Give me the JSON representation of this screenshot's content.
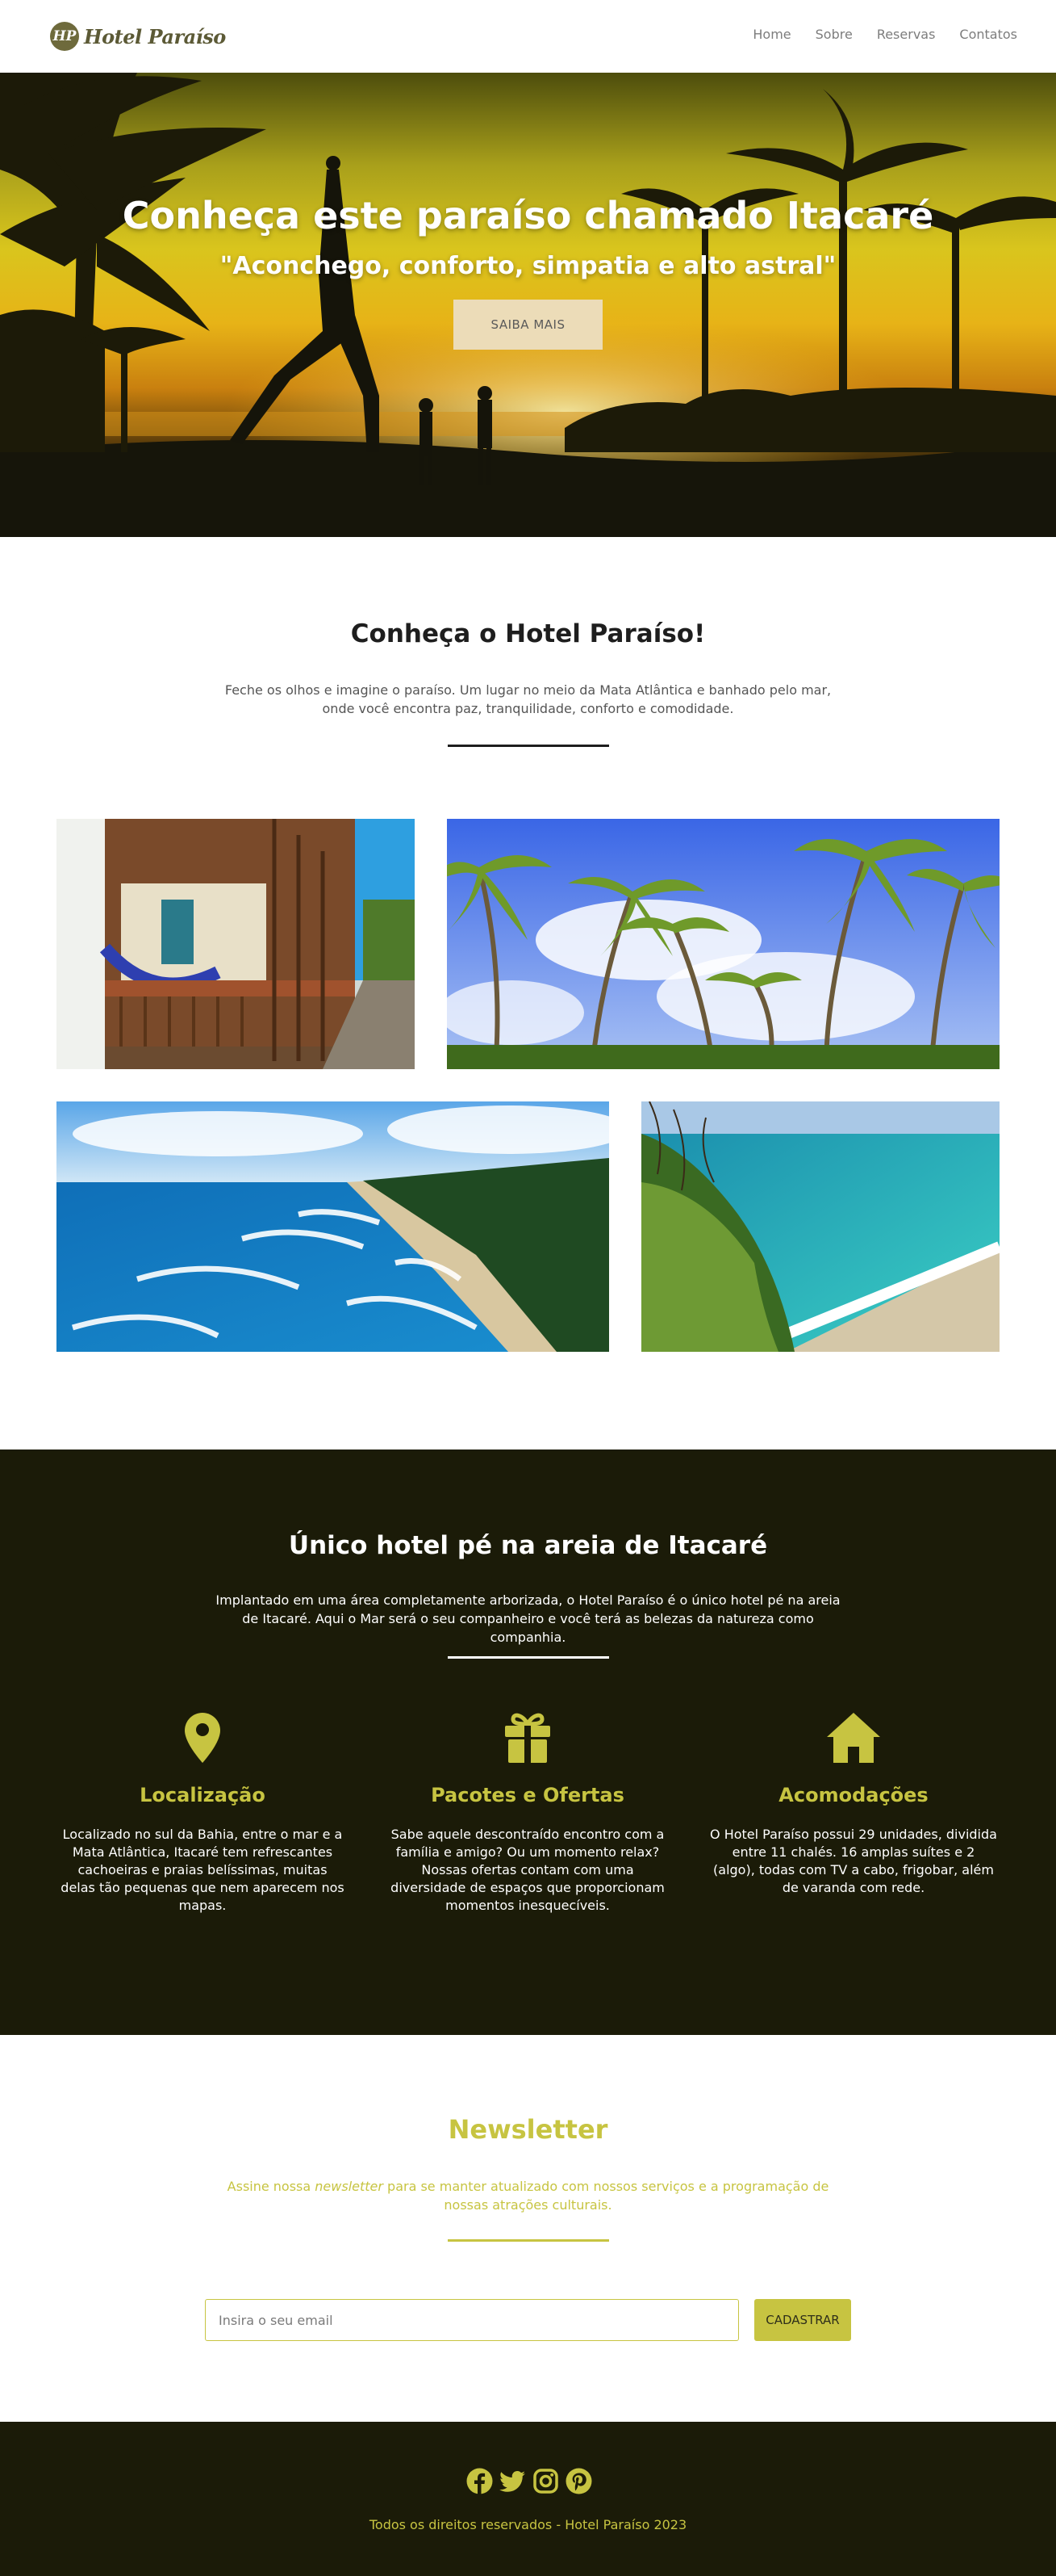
{
  "header": {
    "logo_badge": "HP",
    "logo_text": "Hotel Paraíso",
    "nav": [
      "Home",
      "Sobre",
      "Reservas",
      "Contatos"
    ]
  },
  "hero": {
    "title": "Conheça este paraíso chamado Itacaré",
    "subtitle": "\"Aconchego, conforto, simpatia e alto astral\"",
    "button": "SAIBA MAIS"
  },
  "about": {
    "title": "Conheça o Hotel Paraíso!",
    "text": "Feche os olhos e imagine o paraíso. Um lugar no meio da Mata Atlântica e banhado pelo mar, onde você encontra paz, tranquilidade, conforto e comodidade."
  },
  "gallery": {
    "photos": [
      "hotel-balcony-hammocks",
      "palm-trees-sky",
      "beach-coast-aerial",
      "turquoise-sea-cliff"
    ]
  },
  "highlights": {
    "title": "Único hotel pé na areia de Itacaré",
    "text": "Implantado em uma área completamente arborizada, o Hotel Paraíso é o único hotel pé na areia de Itacaré. Aqui o Mar será o seu companheiro e você terá as belezas da natureza como companhia.",
    "features": [
      {
        "icon": "map-pin-icon",
        "title": "Localização",
        "text": "Localizado no sul da Bahia, entre o mar e a Mata Atlântica, Itacaré tem refrescantes cachoeiras e praias belíssimas, muitas delas tão pequenas que nem aparecem nos mapas."
      },
      {
        "icon": "gift-icon",
        "title": "Pacotes e Ofertas",
        "text": "Sabe aquele descontraído encontro com a família e amigo? Ou um momento relax? Nossas ofertas contam com uma diversidade de espaços que proporcionam momentos inesquecíveis."
      },
      {
        "icon": "house-icon",
        "title": "Acomodações",
        "text": "O Hotel Paraíso possui 29 unidades, dividida entre 11 chalés. 16 amplas suítes e 2 (algo), todas com TV a cabo, frigobar, além de varanda com rede."
      }
    ]
  },
  "newsletter": {
    "title": "Newsletter",
    "text_before": "Assine nossa ",
    "text_emphasis": "newsletter",
    "text_after": " para se manter atualizado com nossos serviços e a programação de nossas atrações culturais.",
    "input_placeholder": "Insira o seu email",
    "button": "CADASTRAR"
  },
  "footer": {
    "socials": [
      "facebook-icon",
      "twitter-icon",
      "instagram-icon",
      "pinterest-icon"
    ],
    "copyright": "Todos os direitos reservados - Hotel Paraíso 2023"
  },
  "colors": {
    "accent": "#c7c441",
    "dark": "#1b1b08",
    "hero_button": "#ecdcb8"
  }
}
